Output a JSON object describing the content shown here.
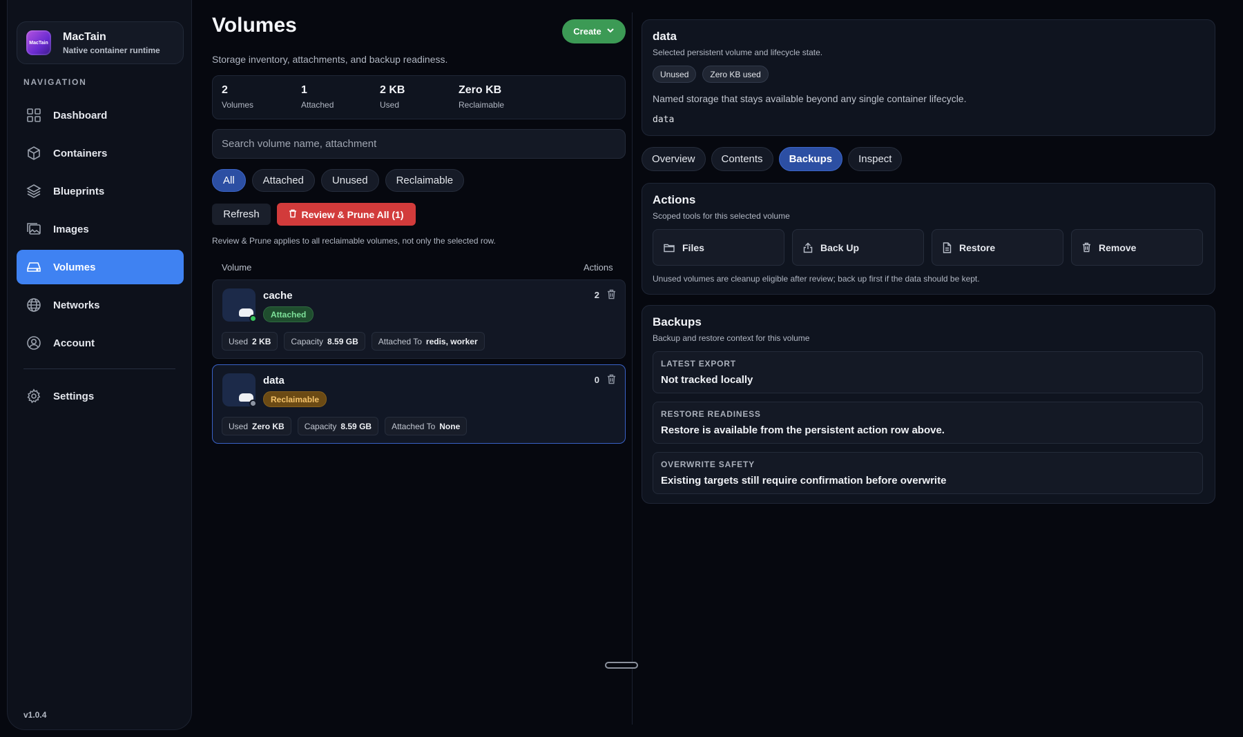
{
  "app": {
    "name": "MacTain",
    "subtitle": "Native container runtime",
    "logo_text": "MacTain",
    "version": "v1.0.4"
  },
  "nav": {
    "heading": "NAVIGATION",
    "items": [
      {
        "label": "Dashboard",
        "icon": "dashboard-icon"
      },
      {
        "label": "Containers",
        "icon": "cube-icon"
      },
      {
        "label": "Blueprints",
        "icon": "layers-icon"
      },
      {
        "label": "Images",
        "icon": "images-icon"
      },
      {
        "label": "Volumes",
        "icon": "drive-icon",
        "active": true
      },
      {
        "label": "Networks",
        "icon": "globe-icon"
      },
      {
        "label": "Account",
        "icon": "user-icon"
      }
    ],
    "settings": "Settings"
  },
  "page": {
    "title": "Volumes",
    "subtitle": "Storage inventory, attachments, and backup readiness.",
    "create_label": "Create"
  },
  "stats": [
    {
      "value": "2",
      "label": "Volumes"
    },
    {
      "value": "1",
      "label": "Attached"
    },
    {
      "value": "2 KB",
      "label": "Used"
    },
    {
      "value": "Zero KB",
      "label": "Reclaimable"
    }
  ],
  "search": {
    "placeholder": "Search volume name, attachment",
    "value": ""
  },
  "filters": [
    {
      "label": "All",
      "active": true
    },
    {
      "label": "Attached"
    },
    {
      "label": "Unused"
    },
    {
      "label": "Reclaimable"
    }
  ],
  "toolbar": {
    "refresh": "Refresh",
    "prune": "Review & Prune All (1)",
    "prune_note": "Review & Prune applies to all reclaimable volumes, not only the selected row."
  },
  "list": {
    "col_volume": "Volume",
    "col_actions": "Actions",
    "rows": [
      {
        "name": "cache",
        "status": "Attached",
        "count": "2",
        "used_label": "Used",
        "used": "2 KB",
        "capacity_label": "Capacity",
        "capacity": "8.59 GB",
        "attached_label": "Attached To",
        "attached": "redis, worker",
        "dot_color": "#36c25a"
      },
      {
        "name": "data",
        "status": "Reclaimable",
        "count": "0",
        "used_label": "Used",
        "used": "Zero KB",
        "capacity_label": "Capacity",
        "capacity": "8.59 GB",
        "attached_label": "Attached To",
        "attached": "None",
        "dot_color": "#8e95a3",
        "selected": true
      }
    ]
  },
  "detail": {
    "title": "data",
    "subtitle": "Selected persistent volume and lifecycle state.",
    "badges": [
      "Unused",
      "Zero KB used"
    ],
    "description": "Named storage that stays available beyond any single container lifecycle.",
    "mono": "data"
  },
  "tabs": [
    {
      "label": "Overview"
    },
    {
      "label": "Contents"
    },
    {
      "label": "Backups",
      "active": true
    },
    {
      "label": "Inspect"
    }
  ],
  "actions": {
    "title": "Actions",
    "subtitle": "Scoped tools for this selected volume",
    "buttons": [
      {
        "label": "Files",
        "icon": "folder-icon"
      },
      {
        "label": "Back Up",
        "icon": "upload-icon"
      },
      {
        "label": "Restore",
        "icon": "document-icon"
      },
      {
        "label": "Remove",
        "icon": "trash-icon"
      }
    ],
    "note": "Unused volumes are cleanup eligible after review; back up first if the data should be kept."
  },
  "backups": {
    "title": "Backups",
    "subtitle": "Backup and restore context for this volume",
    "items": [
      {
        "label": "LATEST EXPORT",
        "value": "Not tracked locally"
      },
      {
        "label": "RESTORE READINESS",
        "value": "Restore is available from the persistent action row above."
      },
      {
        "label": "OVERWRITE SAFETY",
        "value": "Existing targets still require confirmation before overwrite"
      }
    ]
  },
  "colors": {
    "accent": "#3f82f2",
    "create_green": "#3c9a55",
    "prune_red": "#d23b3b",
    "background": "#06080f"
  }
}
